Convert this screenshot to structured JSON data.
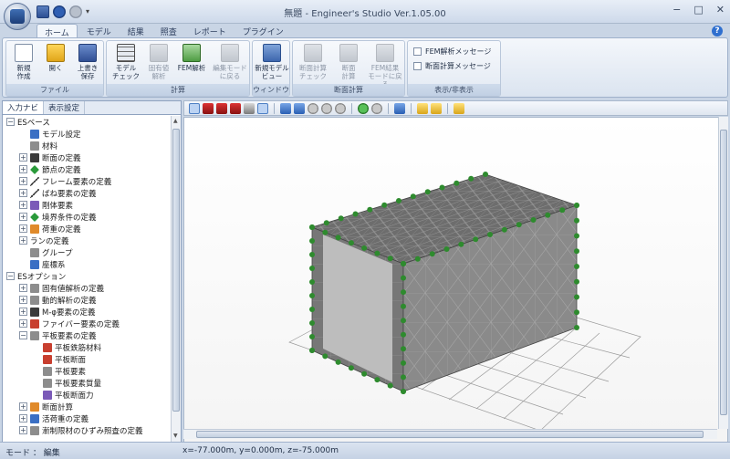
{
  "window": {
    "title": "無題 - Engineer's Studio Ver.1.05.00",
    "controls": [
      "−",
      "□",
      "✕"
    ]
  },
  "quick_access": {
    "more": "▾"
  },
  "ribbon_tabs": [
    "ホーム",
    "モデル",
    "結果",
    "照査",
    "レポート",
    "プラグイン"
  ],
  "help_label": "?",
  "ribbon": {
    "groups": [
      {
        "caption": "ファイル",
        "buttons": [
          {
            "label": "新規\n作成",
            "icon": "new-file-icon"
          },
          {
            "label": "開く",
            "icon": "open-folder-icon"
          },
          {
            "label": "上書き\n保存",
            "icon": "save-icon"
          }
        ]
      },
      {
        "caption": "計算",
        "buttons": [
          {
            "label": "モデル\nチェック",
            "icon": "model-check-icon"
          },
          {
            "label": "固有値\n解析",
            "icon": "eigen-analysis-icon",
            "disabled": true
          },
          {
            "label": "FEM解析",
            "icon": "fem-analysis-icon"
          },
          {
            "label": "編集モード\nに戻る",
            "icon": "edit-mode-icon",
            "disabled": true
          }
        ]
      },
      {
        "caption": "ウィンドウ",
        "buttons": [
          {
            "label": "新規モデル\nビュー",
            "icon": "new-model-view-icon"
          }
        ]
      },
      {
        "caption": "断面計算",
        "buttons": [
          {
            "label": "断面計算\nチェック",
            "icon": "section-check-icon",
            "disabled": true
          },
          {
            "label": "断面\n計算",
            "icon": "section-calc-icon",
            "disabled": true
          },
          {
            "label": "FEM結果\nモードに戻る",
            "icon": "fem-result-mode-icon",
            "disabled": true
          }
        ]
      },
      {
        "caption": "表示/非表示",
        "checks": [
          "FEM解析メッセージ",
          "断面計算メッセージ"
        ]
      }
    ]
  },
  "panel_tabs": [
    "入力ナビ",
    "表示設定"
  ],
  "tree": [
    {
      "level": 0,
      "toggle": "−",
      "label": "ESベース",
      "icon": ""
    },
    {
      "level": 1,
      "toggle": "",
      "label": "モデル設定",
      "icon": "blue"
    },
    {
      "level": 1,
      "toggle": "",
      "label": "材料",
      "icon": "gray"
    },
    {
      "level": 1,
      "toggle": "+",
      "label": "断面の定義",
      "icon": "dark"
    },
    {
      "level": 1,
      "toggle": "+",
      "label": "節点の定義",
      "icon": "green"
    },
    {
      "level": 1,
      "toggle": "+",
      "label": "フレーム要素の定義",
      "icon": "line"
    },
    {
      "level": 1,
      "toggle": "+",
      "label": "ばね要素の定義",
      "icon": "line"
    },
    {
      "level": 1,
      "toggle": "+",
      "label": "剛体要素",
      "icon": "purple"
    },
    {
      "level": 1,
      "toggle": "+",
      "label": "境界条件の定義",
      "icon": "green"
    },
    {
      "level": 1,
      "toggle": "+",
      "label": "荷重の定義",
      "icon": "orange"
    },
    {
      "level": 1,
      "toggle": "+",
      "label": "ランの定義",
      "icon": ""
    },
    {
      "level": 1,
      "toggle": "",
      "label": "グループ",
      "icon": "gray"
    },
    {
      "level": 1,
      "toggle": "",
      "label": "座標系",
      "icon": "blue"
    },
    {
      "level": 0,
      "toggle": "−",
      "label": "ESオプション",
      "icon": ""
    },
    {
      "level": 1,
      "toggle": "+",
      "label": "固有値解析の定義",
      "icon": "gray"
    },
    {
      "level": 1,
      "toggle": "+",
      "label": "動的解析の定義",
      "icon": "gray"
    },
    {
      "level": 1,
      "toggle": "+",
      "label": "M-φ要素の定義",
      "icon": "dark"
    },
    {
      "level": 1,
      "toggle": "+",
      "label": "ファイバー要素の定義",
      "icon": "red"
    },
    {
      "level": 1,
      "toggle": "−",
      "label": "平板要素の定義",
      "icon": "gray"
    },
    {
      "level": 2,
      "toggle": "",
      "label": "平板鉄筋材料",
      "icon": "red"
    },
    {
      "level": 2,
      "toggle": "",
      "label": "平板断面",
      "icon": "red"
    },
    {
      "level": 2,
      "toggle": "",
      "label": "平板要素",
      "icon": "gray"
    },
    {
      "level": 2,
      "toggle": "",
      "label": "平板要素質量",
      "icon": "gray"
    },
    {
      "level": 2,
      "toggle": "",
      "label": "平板断面力",
      "icon": "purple"
    },
    {
      "level": 1,
      "toggle": "+",
      "label": "断面計算",
      "icon": "orange"
    },
    {
      "level": 1,
      "toggle": "+",
      "label": "活荷重の定義",
      "icon": "blue"
    },
    {
      "level": 1,
      "toggle": "+",
      "label": "漸制限材のひずみ照査の定義",
      "icon": "gray"
    }
  ],
  "status": {
    "mode": "モード ： 編集",
    "coordinates": "x=-77.000m, y=0.000m, z=-75.000m"
  },
  "colors": {
    "mesh_face": "#7d7d7d",
    "mesh_top": "#6a6a6a",
    "node": "#2e8b2e",
    "ground_grid": "#9a9a9a"
  }
}
